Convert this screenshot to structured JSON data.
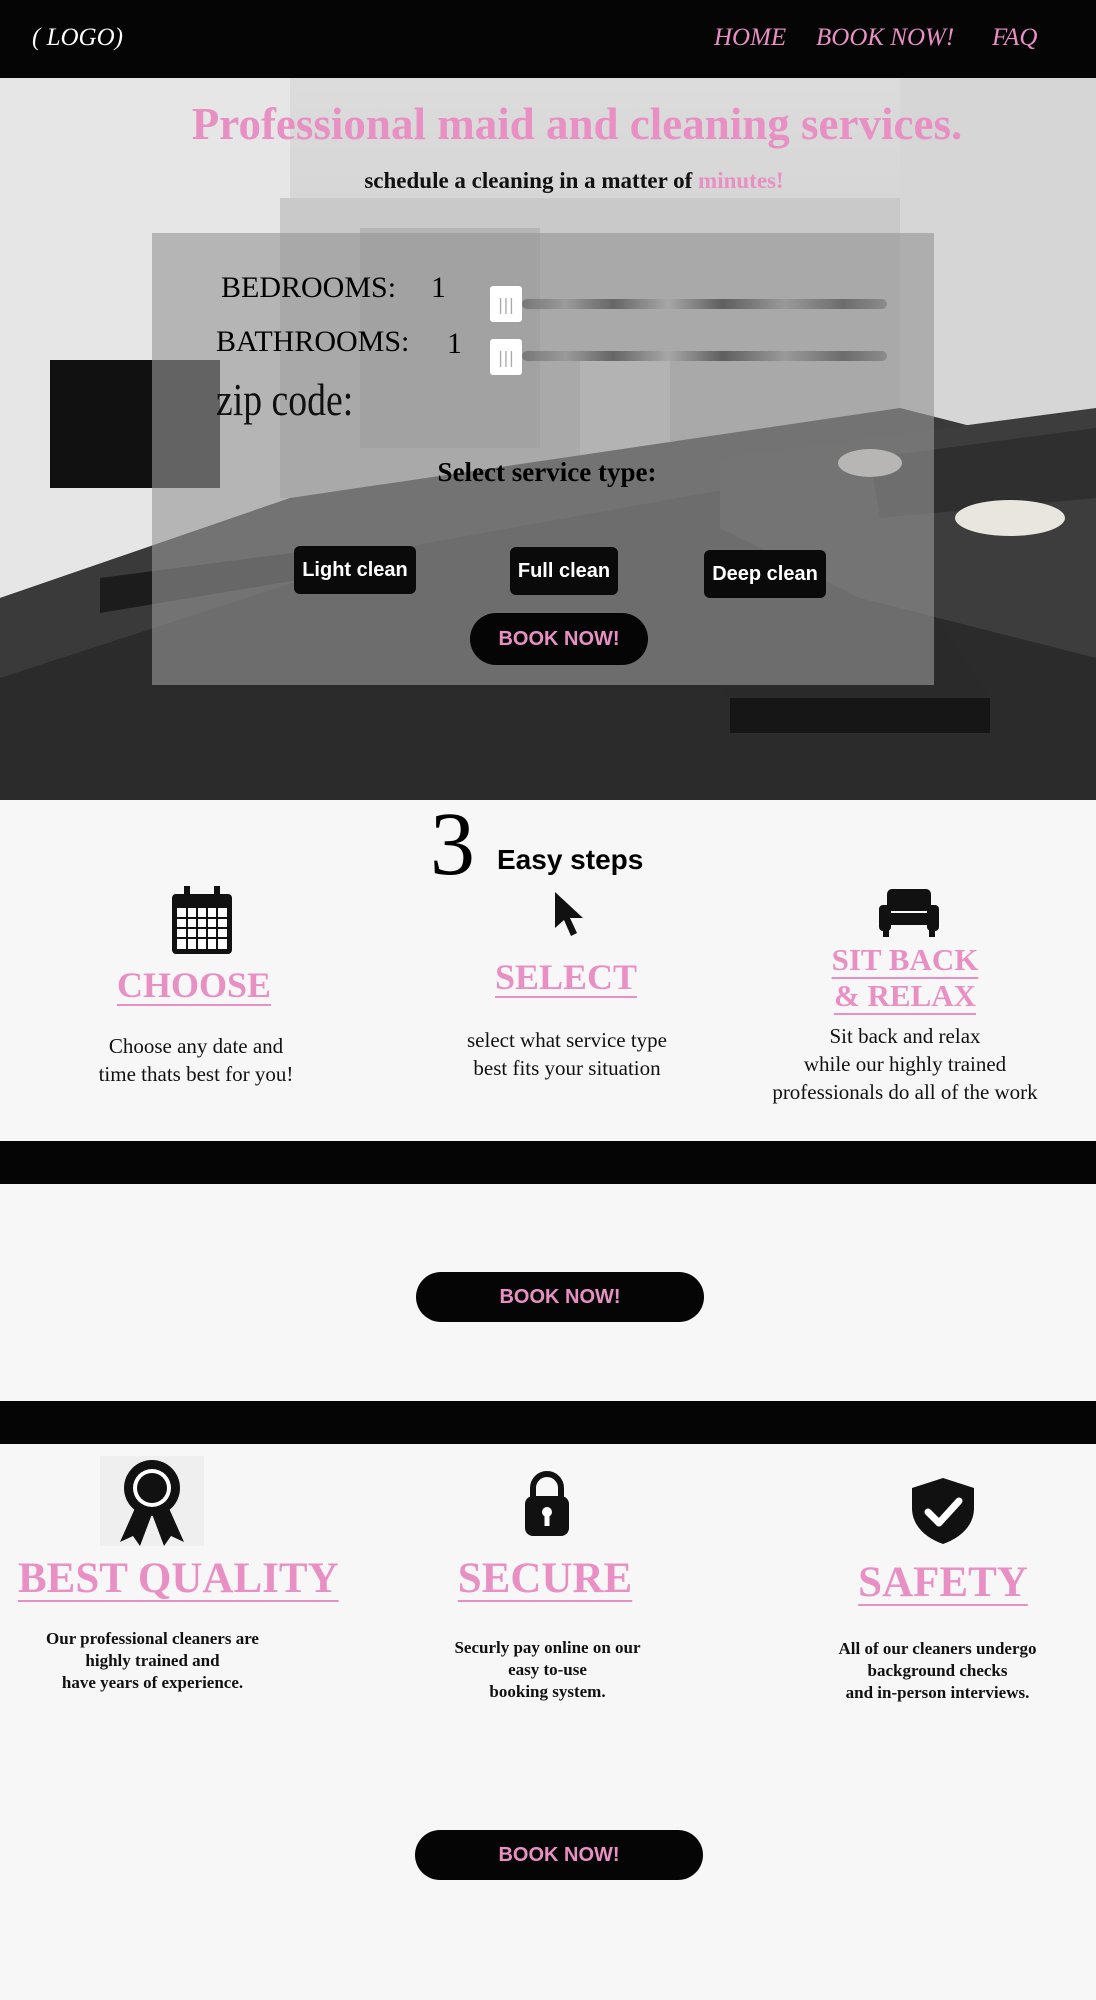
{
  "nav": {
    "logo": "( LOGO)",
    "links": [
      "HOME",
      "BOOK NOW!",
      "FAQ"
    ]
  },
  "hero": {
    "title": "Professional maid and cleaning services.",
    "subtitle_prefix": "schedule a cleaning in a matter of ",
    "subtitle_accent": "minutes!"
  },
  "form": {
    "bedrooms_label": "BEDROOMS:",
    "bedrooms_value": "1",
    "bathrooms_label": "BATHROOMS:",
    "bathrooms_value": "1",
    "zip_label": "zip code:",
    "service_label": "Select service type:",
    "services": [
      "Light clean",
      "Full clean",
      "Deep clean"
    ],
    "book_label": "BOOK NOW!"
  },
  "steps": {
    "number": "3",
    "title": "Easy steps",
    "items": [
      {
        "icon": "calendar-icon",
        "heading": "CHOOSE",
        "text_lines": [
          "Choose any date and",
          "time thats best for you!"
        ]
      },
      {
        "icon": "cursor-icon",
        "heading": "SELECT",
        "text_lines": [
          "select what service type",
          "best fits your situation"
        ]
      },
      {
        "icon": "sofa-icon",
        "heading_lines": [
          "SIT BACK",
          "& RELAX"
        ],
        "text_lines": [
          "Sit back and relax",
          "while our highly trained",
          "professionals do all of the work"
        ]
      }
    ]
  },
  "cta": {
    "book_label_1": "BOOK NOW!",
    "book_label_2": "BOOK NOW!"
  },
  "features": [
    {
      "icon": "award-ribbon-icon",
      "heading": "BEST QUALITY",
      "text_lines": [
        "Our professional cleaners are",
        "highly trained and",
        "have years of experience."
      ]
    },
    {
      "icon": "padlock-icon",
      "heading": "SECURE",
      "text_lines": [
        "Securly pay online on our",
        "easy to-use",
        "booking system."
      ]
    },
    {
      "icon": "shield-check-icon",
      "heading": "SAFETY",
      "text_lines": [
        "All of our cleaners undergo",
        "background checks",
        "and in-person interviews."
      ]
    }
  ],
  "colors": {
    "accent": "#e890c4",
    "dark": "#050505",
    "background": "#f7f7f7"
  }
}
